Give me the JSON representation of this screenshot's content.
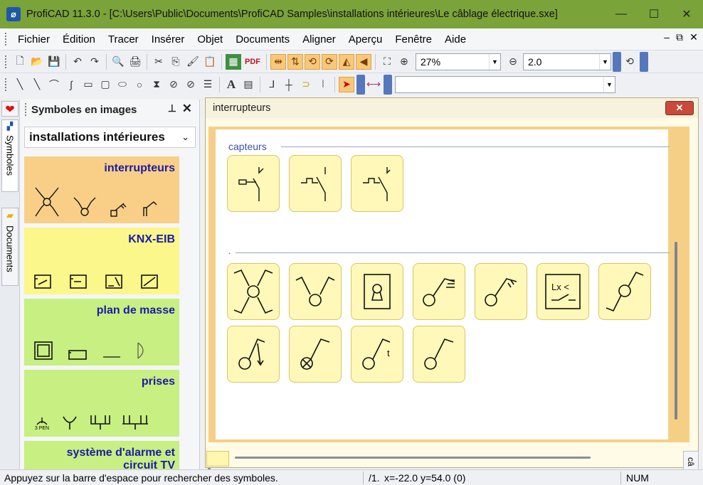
{
  "window": {
    "title": "ProfiCAD 11.3.0 - [C:\\Users\\Public\\Documents\\ProfiCAD Samples\\installations intérieures\\Le câblage électrique.sxe]",
    "minimize": "—",
    "maximize": "☐",
    "close": "✕"
  },
  "menu": {
    "items": [
      "Fichier",
      "Édition",
      "Tracer",
      "Insérer",
      "Objet",
      "Documents",
      "Aligner",
      "Aperçu",
      "Fenêtre",
      "Aide"
    ],
    "mdi_minimize": "–",
    "mdi_restore": "⧉",
    "mdi_close": "✕"
  },
  "toolbar1": {
    "zoom_value": "27%",
    "grid_value": "2.0",
    "pdf_label": "PDF"
  },
  "left_tabs": {
    "symbols": "Symboles",
    "documents": "Documents"
  },
  "panel": {
    "title": "Symboles en images",
    "pin": "📌",
    "close": "✕",
    "library": "installations intérieures",
    "categories": [
      {
        "name": "interrupteurs",
        "color": "#f9cf88"
      },
      {
        "name": "KNX-EIB",
        "color": "#fbf78a"
      },
      {
        "name": "plan de masse",
        "color": "#c7ef82"
      },
      {
        "name": "prises",
        "color": "#c7ef82"
      },
      {
        "name": "système d'alarme et circuit TV",
        "color": "#c7ef82"
      }
    ],
    "prise_label": "3 PEN"
  },
  "child": {
    "title": "interrupteurs",
    "close": "✕",
    "sections": [
      {
        "label": "capteurs"
      },
      {
        "label": "."
      }
    ],
    "tile_text": {
      "lx": "Lx <",
      "t": "t"
    }
  },
  "status": {
    "hint": "Appuyez sur la barre d'espace pour rechercher des symboles.",
    "page": "/1.",
    "coords": "x=-22.0  y=54.0 (0)",
    "num": "NUM"
  },
  "right_tab": "câ"
}
